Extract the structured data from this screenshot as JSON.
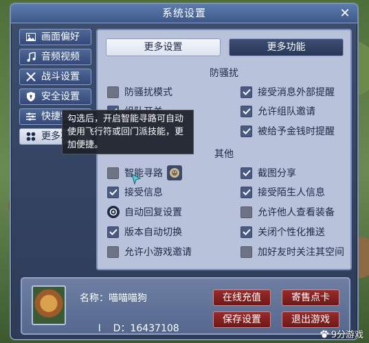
{
  "window": {
    "title": "系统设置"
  },
  "sidebar": {
    "items": [
      {
        "label": "画面偏好",
        "icon": "image-icon"
      },
      {
        "label": "音频视频",
        "icon": "music-note-icon"
      },
      {
        "label": "战斗设置",
        "icon": "crossed-swords-icon"
      },
      {
        "label": "安全设置",
        "icon": "shield-icon"
      },
      {
        "label": "快捷键",
        "icon": "sliders-icon"
      },
      {
        "label": "更多功能",
        "icon": "four-dots-icon",
        "active": true
      }
    ]
  },
  "tabs": [
    {
      "label": "更多设置",
      "active": true
    },
    {
      "label": "更多功能",
      "active": false
    }
  ],
  "sections": {
    "anti_harass": "防骚扰",
    "other": "其他"
  },
  "options": {
    "anti_harass_mode": {
      "label": "防骚扰模式",
      "checked": false
    },
    "accept_external_alert": {
      "label": "接受消息外部提醒",
      "checked": true
    },
    "team_switch": {
      "label": "组队开关",
      "checked": true
    },
    "allow_guild_invite": {
      "label": "允许组队邀请",
      "checked": true
    },
    "money_alert": {
      "label": "被给予金钱时提醒",
      "checked": true
    },
    "smart_pathing": {
      "label": "智能寻路",
      "checked": false
    },
    "screenshot_share": {
      "label": "截图分享",
      "checked": true
    },
    "accept_info": {
      "label": "接受信息",
      "checked": true
    },
    "accept_stranger_info": {
      "label": "接受陌生人信息",
      "checked": true
    },
    "auto_recover": {
      "label": "自动回复设置"
    },
    "allow_view_equip": {
      "label": "允许他人查看装备",
      "checked": false
    },
    "auto_version_switch": {
      "label": "版本自动切换",
      "checked": true
    },
    "disable_personal_push": {
      "label": "关闭个性化推送",
      "checked": true
    },
    "allow_minigame_invite": {
      "label": "允许小游戏邀请",
      "checked": false
    },
    "friend_follow_space": {
      "label": "加好友时关注其空间",
      "checked": false
    }
  },
  "tooltip": {
    "text": "勾选后，开启智能寻路可自动使用飞行符或回门派技能，更加便捷。"
  },
  "player": {
    "name_label": "名称：",
    "name": "喵喵喵狗",
    "id_label": "I    D：",
    "id": "16437108"
  },
  "buttons": {
    "recharge": "在线充值",
    "sell_points": "寄售点卡",
    "save_settings": "保存设置",
    "exit_game": "退出游戏"
  },
  "watermark": {
    "text": "9分游戏"
  }
}
